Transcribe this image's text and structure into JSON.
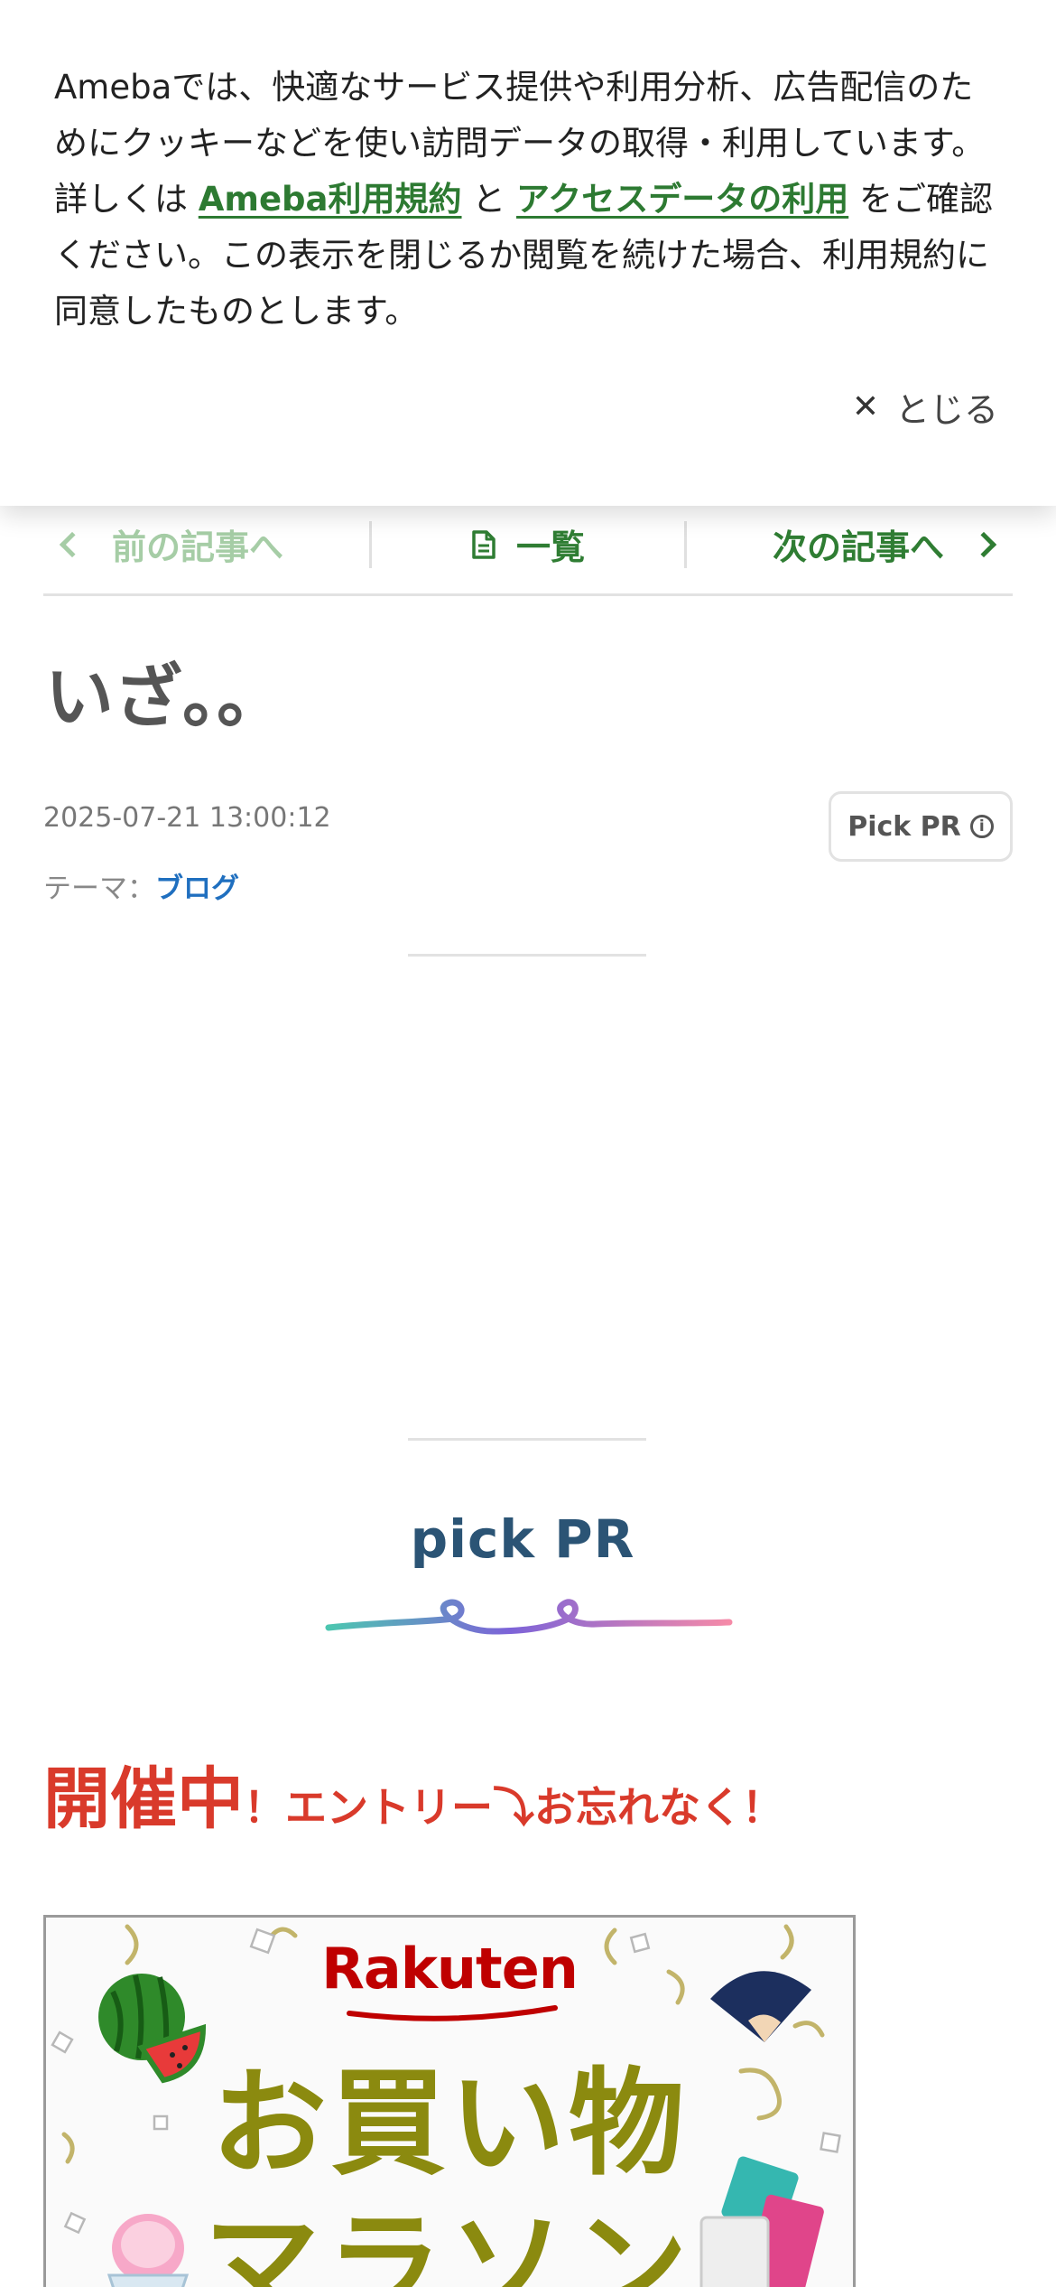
{
  "cookie_banner": {
    "text_part1": "Amebaでは、快適なサービス提供や利用分析、広告配信のためにクッキーなどを使い訪問データの取得・利用しています。詳しくは ",
    "link_terms": "Ameba利用規約",
    "text_and": " と ",
    "link_access_data": "アクセスデータの利用",
    "text_part2": " をご確認ください。この表示を閉じるか閲覧を続けた場合、利用規約に同意したものとします。",
    "close_label": "とじる",
    "close_icon": "close-icon",
    "link_color": "#2d7a32"
  },
  "article_nav": {
    "prev_label": "前の記事へ",
    "list_label": "一覧",
    "next_label": "次の記事へ",
    "prev_icon": "chevron-left-icon",
    "list_icon": "document-icon",
    "next_icon": "chevron-right-icon",
    "active_color": "#2f7d33",
    "disabled_color": "#a6cda6"
  },
  "article": {
    "title": "いざ。。",
    "date": "2025-07-21 13:00:12",
    "theme_label": "テーマ：",
    "theme_value": "ブログ",
    "pick_button_label": "Pick PR",
    "pick_button_icon": "info-icon"
  },
  "pick_pr": {
    "title": "pick PR",
    "promo_big": "開催中",
    "promo_small": "！エントリー⤵お忘れなく！",
    "promo_color": "#d93a2b"
  },
  "ad": {
    "brand": "Rakuten",
    "line1": "お買い物",
    "line2": "マラソン",
    "brand_color": "#bf0000",
    "text_color": "#8b8a0f"
  }
}
